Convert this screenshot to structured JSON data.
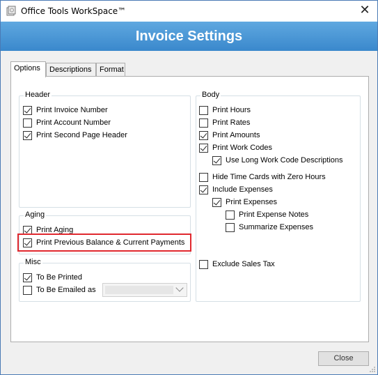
{
  "window": {
    "title": "Office Tools WorkSpace™",
    "close_glyph": "✕"
  },
  "banner": {
    "title": "Invoice Settings"
  },
  "tabs": [
    {
      "label": "Options",
      "active": true
    },
    {
      "label": "Descriptions",
      "active": false
    },
    {
      "label": "Format",
      "active": false
    }
  ],
  "header_group": {
    "label": "Header",
    "items": [
      {
        "label": "Print Invoice Number",
        "checked": true
      },
      {
        "label": "Print Account Number",
        "checked": false
      },
      {
        "label": "Print Second Page Header",
        "checked": true
      }
    ]
  },
  "aging_group": {
    "label": "Aging",
    "items": [
      {
        "label": "Print Aging",
        "checked": true
      },
      {
        "label": "Print Previous Balance & Current Payments",
        "checked": true
      }
    ]
  },
  "misc_group": {
    "label": "Misc",
    "items": [
      {
        "label": "To Be Printed",
        "checked": true
      },
      {
        "label": "To Be Emailed as",
        "checked": false
      }
    ],
    "email_format_value": ""
  },
  "body_group": {
    "label": "Body",
    "items": [
      {
        "label": "Print Hours",
        "checked": false
      },
      {
        "label": "Print Rates",
        "checked": false
      },
      {
        "label": "Print Amounts",
        "checked": true
      },
      {
        "label": "Print Work Codes",
        "checked": true
      },
      {
        "label": "Use Long Work Code Descriptions",
        "checked": true
      },
      {
        "label": "Hide Time Cards with Zero Hours",
        "checked": false
      },
      {
        "label": "Include Expenses",
        "checked": true
      },
      {
        "label": "Print Expenses",
        "checked": true
      },
      {
        "label": "Print Expense Notes",
        "checked": false
      },
      {
        "label": "Summarize Expenses",
        "checked": false
      },
      {
        "label": "Exclude Sales Tax",
        "checked": false
      }
    ]
  },
  "footer": {
    "close_label": "Close"
  },
  "colors": {
    "banner": "#3a88cc",
    "highlight": "#e0282e",
    "window_border": "#4a7ab5"
  }
}
